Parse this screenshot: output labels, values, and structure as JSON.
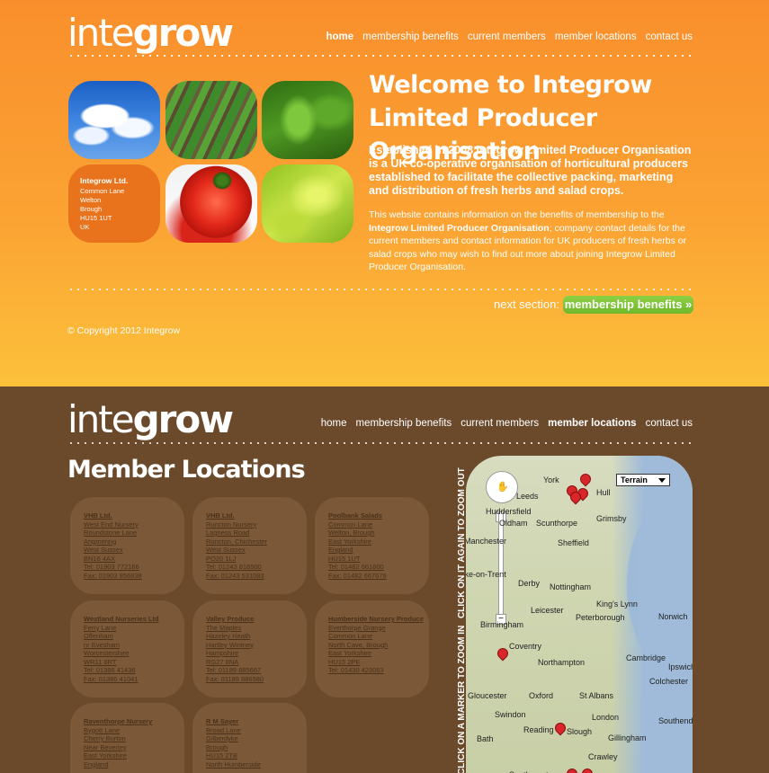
{
  "logo": {
    "thin": "inte",
    "bold": "grow"
  },
  "nav_orange": {
    "home": "home",
    "benefits": "membership benefits",
    "members": "current members",
    "locations": "member locations",
    "contact": "contact us"
  },
  "nav_brown": {
    "home": "home",
    "benefits": "membership benefits",
    "members": "current members",
    "locations": "member locations",
    "contact": "contact us"
  },
  "address": {
    "name": "Integrow Ltd.",
    "lines": [
      "Common Lane",
      "Welton",
      "Brough",
      "HU15 1UT",
      "UK"
    ]
  },
  "welcome": {
    "title": "Welcome to Integrow Limited Producer Organisation"
  },
  "lead": "Established in 2008 Integrow Limited Producer Organisation is a UK co-operative organisation of horticultural producers established to facilitate the collective packing, marketing and distribution of fresh herbs and salad crops.",
  "body": {
    "part1": "This website contains information on the benefits of membership to the ",
    "bold": "Integrow Limited Producer Organisation",
    "part2": "; company contact details for the current members and contact information for UK producers of fresh herbs or salad crops who may wish to find out more about joining Integrow Limited Producer Organisation."
  },
  "next": {
    "label": "next section:",
    "button": "membership benefits »"
  },
  "copyright": "© Copyright 2012 Integrow",
  "member_locations": {
    "title": "Member Locations",
    "cards": [
      {
        "name": "VHB Ltd.",
        "lines": [
          "West End Nursery",
          "Roundstone Lane",
          "Angmering",
          "West Sussex",
          "BN16 4AX",
          "Tel: 01903 772166",
          "Fax: 01903 856838"
        ]
      },
      {
        "name": "VHB Ltd.",
        "lines": [
          "Runcton Nursery",
          "Lagness Road",
          "Runcton, Chichester",
          "West Sussex",
          "PO20 1LJ",
          "Tel: 01243 818500",
          "Fax: 01243 531083"
        ]
      },
      {
        "name": "Poolbank Salads",
        "lines": [
          "Common Lane",
          "Welton, Brough",
          "East Yorkshire",
          "England",
          "HU15 1UT",
          "Tel: 01482 661600",
          "Fax: 01482 667676"
        ]
      },
      {
        "name": "Westland Nurseries Ltd",
        "lines": [
          "Ferry Lane",
          "Offenham",
          "nr Evesham",
          "Worcestershire",
          "WR11 8RT",
          "Tel: 01386 41436",
          "Fax: 01386 41041"
        ]
      },
      {
        "name": "Valley Produce",
        "lines": [
          "The Maples",
          "Hazeley Heath",
          "Hartley Wintney",
          "Hampshire",
          "RG27 8NA",
          "Tel: 01189 885667",
          "Fax: 01189 886580"
        ]
      },
      {
        "name": "Humberside Nursery Produce",
        "lines": [
          "Everthorpe Grange",
          "Common Lane",
          "North Cave, Brough",
          "East Yorkshire",
          "HU15 2PE",
          "Tel: 01430 423063"
        ]
      },
      {
        "name": "Raventhorpe Nursery",
        "lines": [
          "Bygott Lane",
          "Cherry Burton",
          "Near Beverley",
          "East Yorkshire",
          "England"
        ]
      },
      {
        "name": "R M Sayer",
        "lines": [
          "Broad Lane",
          "Gilberdyke",
          "Brough",
          "HU15 2TB",
          "North Humberside"
        ]
      }
    ]
  },
  "map": {
    "terrain": "Terrain",
    "click_out": "CLICK ON IT AGAIN TO ZOOM OUT",
    "click_in": "CLICK ON A MARKER TO ZOOM IN",
    "cities": [
      "York",
      "Hull",
      "Leeds",
      "Huddersfield",
      "Oldham",
      "Scunthorpe",
      "Grimsby",
      "Sheffield",
      "Manchester",
      "Stoke-on-Trent",
      "Derby",
      "Nottingham",
      "King's Lynn",
      "Peterborough",
      "Norwich",
      "Birmingham",
      "Leicester",
      "Coventry",
      "Northampton",
      "Cambridge",
      "Ipswich",
      "Colchester",
      "Gloucester",
      "Oxford",
      "St Albans",
      "Swindon",
      "London",
      "Southend",
      "Reading",
      "Slough",
      "Gillingham",
      "Bath",
      "Crawley",
      "Southampton"
    ]
  }
}
